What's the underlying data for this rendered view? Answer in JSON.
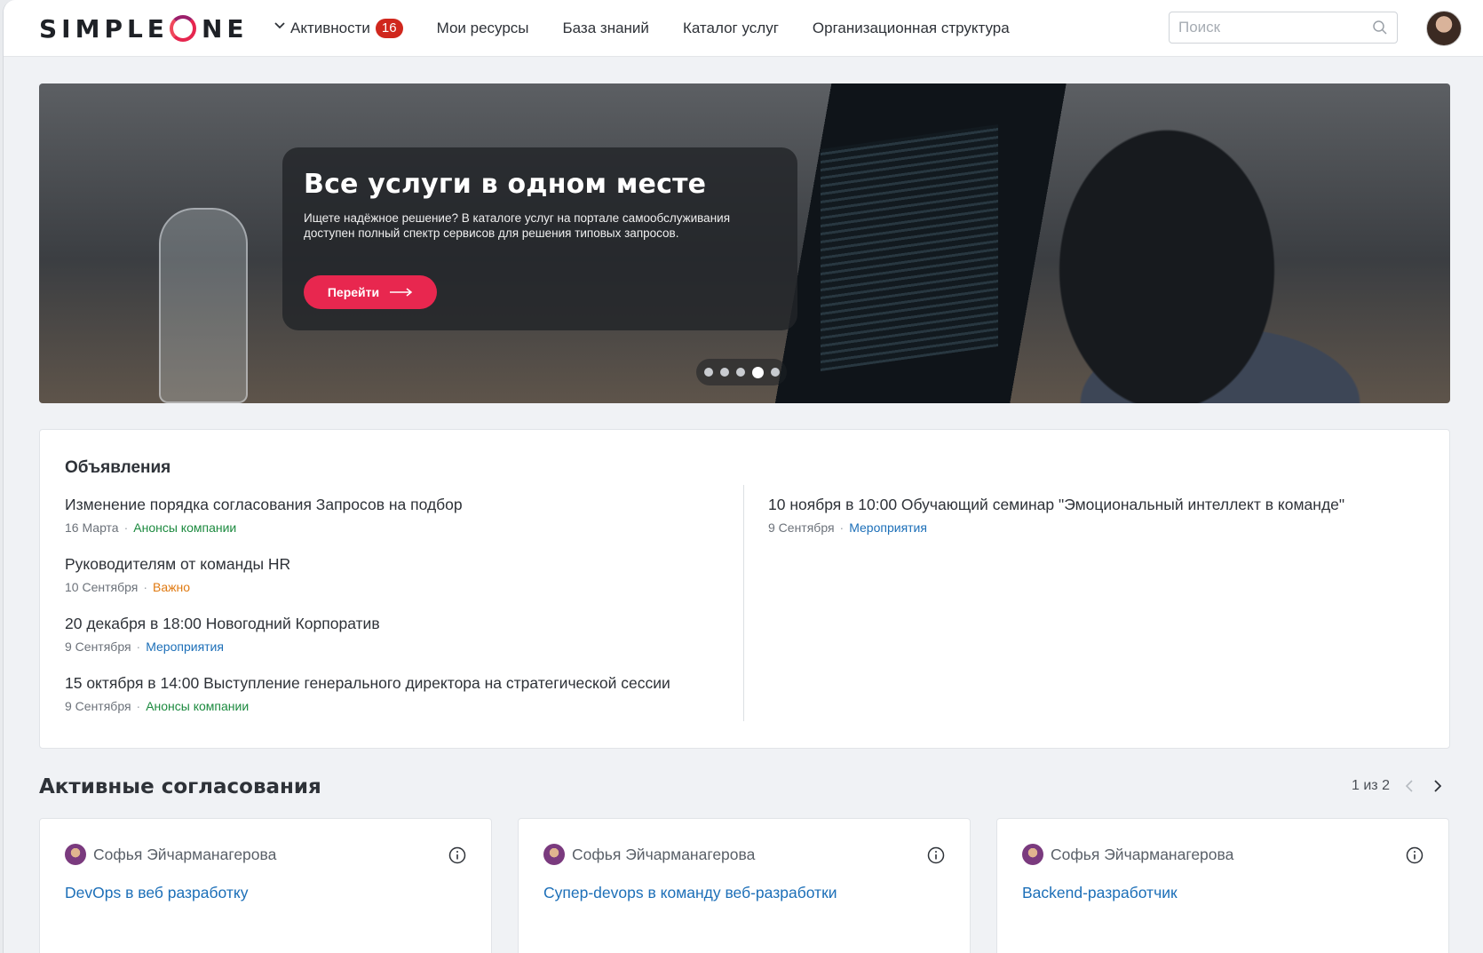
{
  "header": {
    "logo_pre": "SIMPLE",
    "logo_post": "NE",
    "nav": {
      "activities_label": "Активности",
      "activities_count": "16",
      "my_resources": "Мои ресурсы",
      "knowledge_base": "База знаний",
      "service_catalog": "Каталог услуг",
      "org_structure": "Организационная структура"
    },
    "search": {
      "placeholder": "Поиск",
      "value": ""
    }
  },
  "hero": {
    "title": "Все услуги в одном месте",
    "text": "Ищете надёжное решение? В каталоге услуг на портале самообслуживания доступен полный спектр сервисов для решения типовых запросов.",
    "button_label": "Перейти",
    "slides_total": 5,
    "active_slide": 4
  },
  "announcements": {
    "title": "Объявления",
    "left": [
      {
        "title": "Изменение порядка согласования Запросов на подбор",
        "date": "16 Марта",
        "category": "Анонсы компании",
        "category_color": "green"
      },
      {
        "title": "Руководителям от команды HR",
        "date": "10 Сентября",
        "category": "Важно",
        "category_color": "orange"
      },
      {
        "title": "20 декабря в 18:00 Новогодний Корпоратив",
        "date": "9 Сентября",
        "category": "Мероприятия",
        "category_color": "blue"
      },
      {
        "title": "15 октября в 14:00 Выступление генерального директора на стратегической сессии",
        "date": "9 Сентября",
        "category": "Анонсы компании",
        "category_color": "green"
      }
    ],
    "right": [
      {
        "title": "10 ноября в 10:00 Обучающий семинар \"Эмоциональный интеллект в команде\"",
        "date": "9 Сентября",
        "category": "Мероприятия",
        "category_color": "blue"
      }
    ]
  },
  "approvals": {
    "title": "Активные согласования",
    "pager": "1 из 2",
    "cards": [
      {
        "user": "Софья Эйчарманагерова",
        "link": "DevOps в веб разработку"
      },
      {
        "user": "Софья Эйчарманагерова",
        "link": "Супер-devops в команду веб-разработки"
      },
      {
        "user": "Софья Эйчарманагерова",
        "link": "Backend-разработчик"
      }
    ]
  },
  "colors": {
    "accent": "#e8274f",
    "badge": "#d0271d",
    "link": "#1c6fb8",
    "green": "#1c8a3f",
    "orange": "#e07a12",
    "background": "#f0f2f5"
  },
  "icons": [
    "chevron-down-icon",
    "search-icon",
    "arrow-right-icon",
    "info-icon",
    "chevron-left-icon",
    "chevron-right-icon"
  ]
}
